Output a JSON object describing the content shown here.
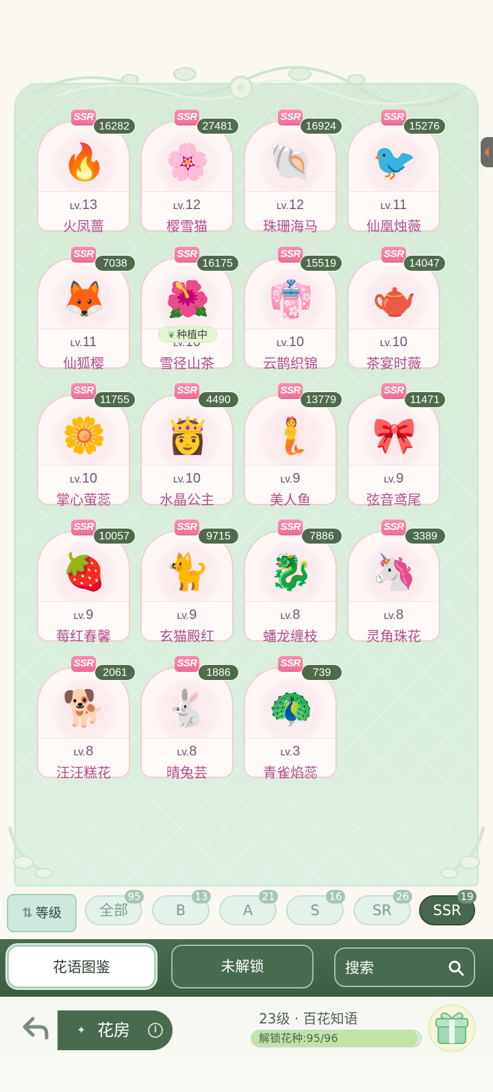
{
  "colors": {
    "accent": "#4a6b50",
    "name_text": "#b04e8a",
    "badge_ssr": "#f06e98"
  },
  "rarity_tag": "SSR",
  "level_prefix": "LV.",
  "cards": [
    {
      "count": "16282",
      "level": "13",
      "name": "火凤蔷",
      "art": "🔥"
    },
    {
      "count": "27481",
      "level": "12",
      "name": "樱雪猫",
      "art": "🌸"
    },
    {
      "count": "16924",
      "level": "12",
      "name": "珠珊海马",
      "art": "🐚"
    },
    {
      "count": "15276",
      "level": "11",
      "name": "仙凰烛薇",
      "art": "🐦"
    },
    {
      "count": "7038",
      "level": "11",
      "name": "仙狐樱",
      "art": "🦊"
    },
    {
      "count": "16175",
      "level": "10",
      "name": "雪径山茶",
      "art": "🌺",
      "status": "种植中"
    },
    {
      "count": "15519",
      "level": "10",
      "name": "云鹊织锦",
      "art": "👘"
    },
    {
      "count": "14047",
      "level": "10",
      "name": "茶宴时薇",
      "art": "🫖"
    },
    {
      "count": "11755",
      "level": "10",
      "name": "掌心萤蕊",
      "art": "🌼"
    },
    {
      "count": "4490",
      "level": "10",
      "name": "水晶公主",
      "art": "👸"
    },
    {
      "count": "13779",
      "level": "9",
      "name": "美人鱼",
      "art": "🧜"
    },
    {
      "count": "11471",
      "level": "9",
      "name": "弦音鸢尾",
      "art": "🎀"
    },
    {
      "count": "10057",
      "level": "9",
      "name": "莓红春馨",
      "art": "🍓"
    },
    {
      "count": "9715",
      "level": "9",
      "name": "玄猫殿红",
      "art": "🐈"
    },
    {
      "count": "7886",
      "level": "8",
      "name": "蟠龙缠枝",
      "art": "🐉"
    },
    {
      "count": "3389",
      "level": "8",
      "name": "灵角珠花",
      "art": "🦄"
    },
    {
      "count": "2061",
      "level": "8",
      "name": "汪汪糕花",
      "art": "🐕"
    },
    {
      "count": "1886",
      "level": "8",
      "name": "晴兔芸",
      "art": "🐇"
    },
    {
      "count": "739",
      "level": "3",
      "name": "青雀焰蕊",
      "art": "🦚"
    }
  ],
  "filter": {
    "sort_label": "等级",
    "pills": [
      {
        "label": "全部",
        "count": "95"
      },
      {
        "label": "B",
        "count": "13"
      },
      {
        "label": "A",
        "count": "21"
      },
      {
        "label": "S",
        "count": "16"
      },
      {
        "label": "SR",
        "count": "26"
      },
      {
        "label": "SSR",
        "count": "19",
        "active": true
      }
    ]
  },
  "tabs": {
    "catalog": "花语图鉴",
    "locked": "未解锁",
    "search_placeholder": "搜索"
  },
  "footer": {
    "home_label": "花房",
    "level_text": "23级 · 百花知语",
    "unlock_text": "解锁花种:95/96",
    "unlock_fraction": 0.9896
  }
}
